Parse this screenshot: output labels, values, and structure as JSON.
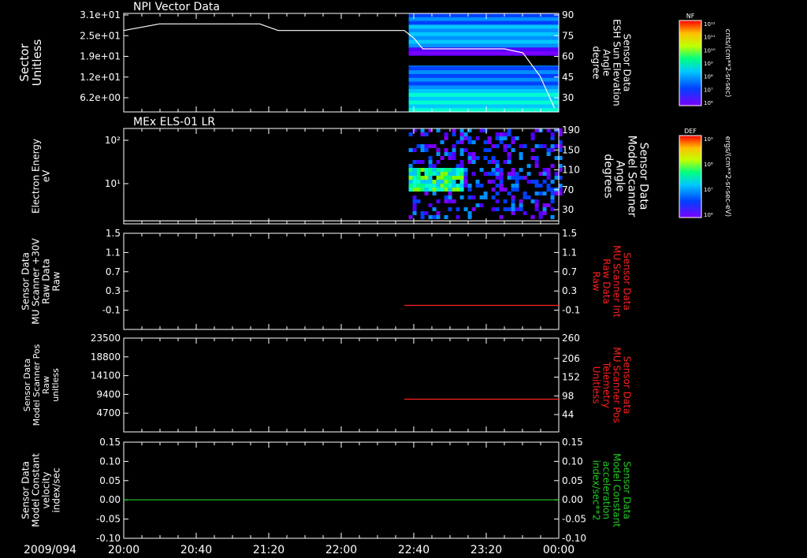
{
  "date_label": "2009/094",
  "colors": {
    "background": "#000000",
    "foreground": "#ffffff",
    "red_trace": "#ff2020",
    "green_trace": "#22cc22"
  },
  "colorbars": [
    {
      "title": "NF",
      "unit": "cnts/(cm**2-sr-sec)",
      "ticks": [
        "10¹²",
        "10¹¹",
        "10¹⁰",
        "10⁹",
        "10⁸",
        "10⁷",
        "10⁶"
      ]
    },
    {
      "title": "DEF",
      "unit": "ergs/(cm**2-sr-sec-eV)",
      "ticks": [
        "10⁹",
        "10⁸",
        "10⁷",
        "10⁶"
      ]
    }
  ],
  "chart_data": [
    {
      "type": "heatmap",
      "title": "NPI Vector Data",
      "ylabel_left": [
        "Sector",
        "Unitless"
      ],
      "yticks_left": [
        "3.1e+01",
        "2.5e+01",
        "1.9e+01",
        "1.2e+01",
        "6.2e+00"
      ],
      "ylabel_right": [
        "Sensor Data",
        "ESH Sun Elevation",
        "Angle",
        "degree"
      ],
      "yticks_right": [
        "90",
        "75",
        "60",
        "45",
        "30"
      ],
      "ylim_right": [
        15,
        90
      ],
      "x_hours": [
        20.0,
        20.33,
        20.67,
        21.25,
        21.42,
        22.0,
        22.58,
        22.67,
        22.75,
        23.33,
        23.5,
        23.67,
        23.83,
        23.96
      ],
      "line_values": [
        77,
        82,
        82,
        82,
        77,
        77,
        77,
        71,
        63,
        63,
        63,
        60,
        42,
        18
      ],
      "heatmap_x_range": [
        22.62,
        24.0
      ]
    },
    {
      "type": "heatmap",
      "title": "MEx ELS-01 LR",
      "ylabel_left": [
        "Electron Energy",
        "eV"
      ],
      "yticks_left": [
        "10²",
        "10¹"
      ],
      "yscale": "log",
      "ylabel_right": [
        "Sensor Data",
        "Model Scanner",
        "Angle",
        "degrees"
      ],
      "yticks_right": [
        "190",
        "150",
        "110",
        "70",
        "30"
      ],
      "ylim_right": [
        0,
        190
      ],
      "x_hours": [
        20.0,
        24.0
      ],
      "line_values": [
        6,
        6
      ],
      "heatmap_x_range": [
        22.62,
        24.0
      ]
    },
    {
      "type": "line",
      "ylabel_left": [
        "Sensor Data",
        "MU Scanner +30V",
        "Raw Data",
        "Raw"
      ],
      "yticks_left": [
        "1.5",
        "1.1",
        "0.7",
        "0.3",
        "-0.1"
      ],
      "ylim": [
        -0.5,
        1.5
      ],
      "ylabel_right": [
        "Sensor Data",
        "MU Scanner Int",
        "Raw Data",
        "Raw"
      ],
      "yticks_right": [
        "1.5",
        "1.1",
        "0.7",
        "0.3",
        "-0.1"
      ],
      "series": [
        {
          "x_hours": [
            22.58,
            24.0
          ],
          "values": [
            0.0,
            0.0
          ]
        }
      ]
    },
    {
      "type": "line",
      "ylabel_left": [
        "Sensor Data",
        "Model Scanner Pos",
        "Raw",
        "unitless"
      ],
      "yticks_left": [
        "23500",
        "18800",
        "14100",
        "9400",
        "4700"
      ],
      "ylim": [
        0,
        23500
      ],
      "ylabel_right": [
        "Sensor Data",
        "MU Scanner Pos",
        "Telemetry",
        "Unitless"
      ],
      "yticks_right": [
        "260",
        "206",
        "152",
        "98",
        "44"
      ],
      "series": [
        {
          "x_hours": [
            22.58,
            24.0
          ],
          "values": [
            8200,
            8200
          ]
        }
      ]
    },
    {
      "type": "line",
      "ylabel_left": [
        "Sensor Data",
        "Model Constant",
        "velocity",
        "index/sec"
      ],
      "yticks_left": [
        "0.15",
        "0.10",
        "0.05",
        "0.00",
        "-0.05",
        "-0.10"
      ],
      "ylim": [
        -0.1,
        0.15
      ],
      "ylabel_right": [
        "Sensor Data",
        "Model Constant",
        "acceleration",
        "index/sec**2"
      ],
      "yticks_right": [
        "0.15",
        "0.10",
        "0.05",
        "0.00",
        "-0.05",
        "-0.10"
      ],
      "series": [
        {
          "x_hours": [
            20.0,
            24.0
          ],
          "values": [
            0.0,
            0.0
          ]
        }
      ]
    }
  ],
  "x_axis": {
    "range_hours": [
      20.0,
      24.0
    ],
    "tick_labels": [
      "20:00",
      "20:40",
      "21:20",
      "22:00",
      "22:40",
      "23:20",
      "00:00"
    ]
  }
}
